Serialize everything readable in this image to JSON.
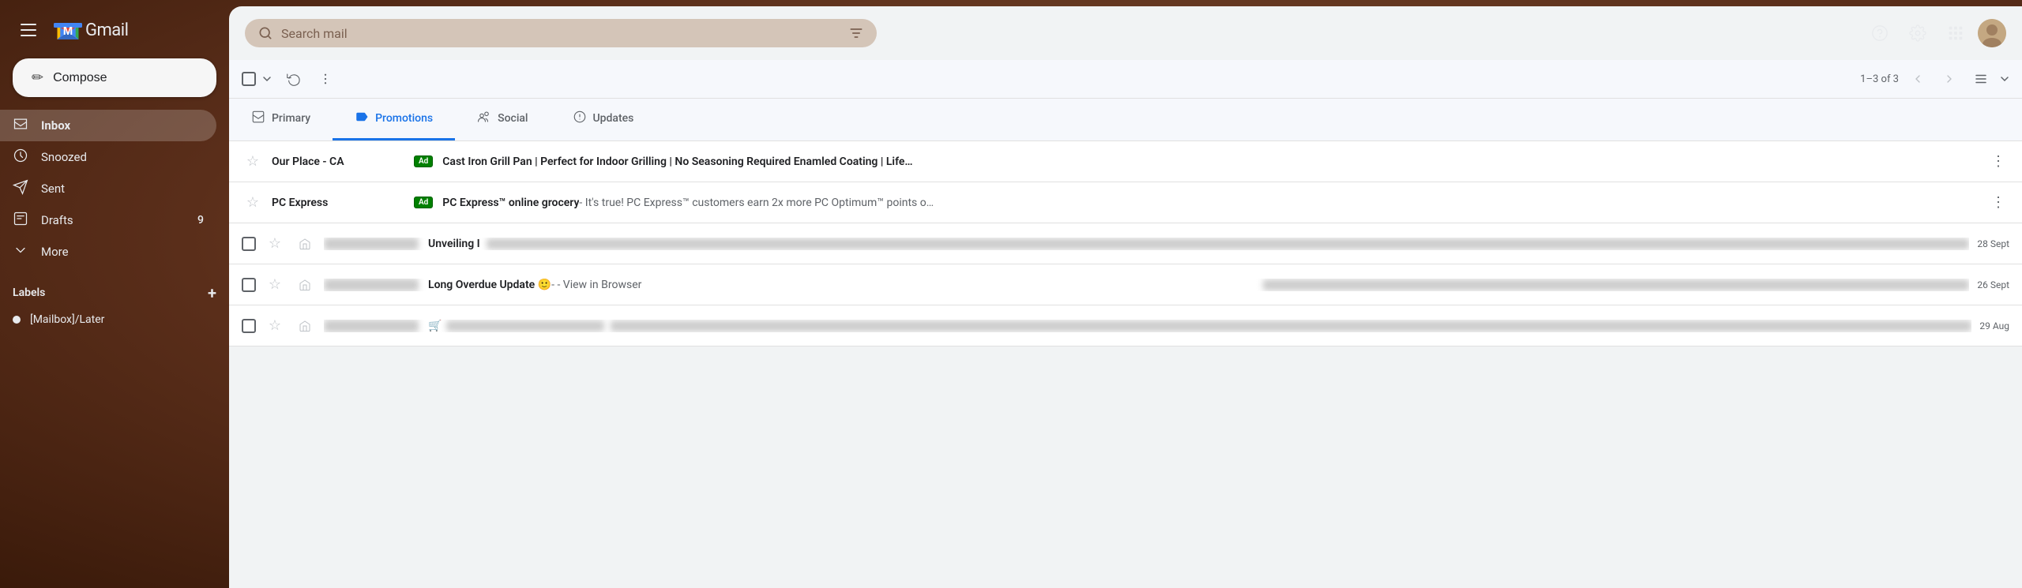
{
  "sidebar": {
    "app_title": "Gmail",
    "compose_label": "Compose",
    "nav_items": [
      {
        "id": "inbox",
        "label": "Inbox",
        "icon": "☰",
        "active": true,
        "badge": ""
      },
      {
        "id": "snoozed",
        "label": "Snoozed",
        "icon": "⏰",
        "active": false,
        "badge": ""
      },
      {
        "id": "sent",
        "label": "Sent",
        "icon": "▶",
        "active": false,
        "badge": ""
      },
      {
        "id": "drafts",
        "label": "Drafts",
        "icon": "📄",
        "active": false,
        "badge": "9"
      },
      {
        "id": "more",
        "label": "More",
        "icon": "∨",
        "active": false,
        "badge": ""
      }
    ],
    "labels_title": "Labels",
    "label_items": [
      {
        "id": "mailbox-later",
        "label": "[Mailbox]/Later"
      }
    ]
  },
  "search": {
    "placeholder": "Search mail"
  },
  "toolbar": {
    "select_all_label": "Select all",
    "refresh_label": "Refresh",
    "more_label": "More options",
    "email_count": "1–3 of 3"
  },
  "tabs": [
    {
      "id": "primary",
      "label": "Primary",
      "icon": "☰",
      "active": false
    },
    {
      "id": "promotions",
      "label": "Promotions",
      "icon": "🏷",
      "active": true
    },
    {
      "id": "social",
      "label": "Social",
      "icon": "👥",
      "active": false
    },
    {
      "id": "updates",
      "label": "Updates",
      "icon": "ℹ",
      "active": false
    }
  ],
  "emails": [
    {
      "id": "1",
      "sender": "Our Place - CA",
      "ad": true,
      "subject": "Cast Iron Grill Pan | Perfect for Indoor Grilling | No Seasoning Required Enamled Coating | Life…",
      "snippet": "",
      "date": "",
      "blurred": false,
      "has_more": true
    },
    {
      "id": "2",
      "sender": "PC Express",
      "ad": true,
      "subject": "PC Express™ online grocery",
      "snippet": "It's true! PC Express™ customers earn 2x more PC Optimum™ points o…",
      "date": "",
      "blurred": false,
      "has_more": true
    },
    {
      "id": "3",
      "sender": "BLURRED_SENDER_1",
      "ad": false,
      "subject": "Unveiling I",
      "snippet": "BLURRED_CONTENT",
      "date": "28 Sept",
      "blurred": true,
      "has_more": false
    },
    {
      "id": "4",
      "sender": "BLURRED_SENDER_2",
      "ad": false,
      "subject": "Long Overdue Update 🙂",
      "snippet": "View in Browser BLURRED_CONTENT",
      "date": "26 Sept",
      "blurred": true,
      "has_more": false
    },
    {
      "id": "5",
      "sender": "BLURRED_SENDER_3",
      "ad": false,
      "subject": "🛒 BLURRED_SUBJECT",
      "snippet": "BLURRED_CONTENT",
      "date": "29 Aug",
      "blurred": true,
      "has_more": false
    }
  ],
  "colors": {
    "active_tab": "#1a73e8",
    "ad_badge": "#008000",
    "sidebar_bg": "transparent",
    "main_bg": "#f6f8fc"
  }
}
